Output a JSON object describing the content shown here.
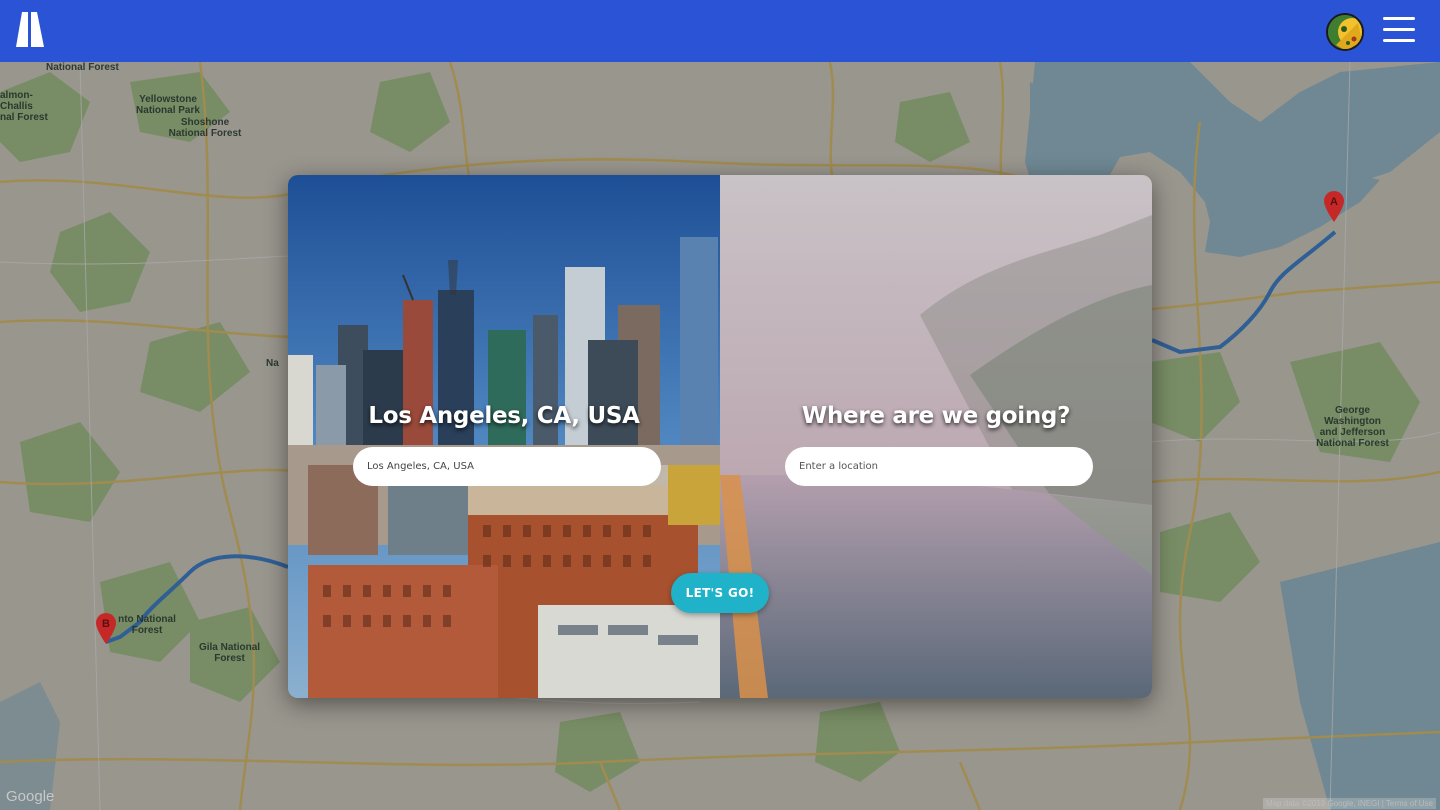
{
  "header": {
    "logo_icon": "trip-logo-icon",
    "avatar_icon": "user-avatar",
    "menu_icon": "hamburger-menu-icon",
    "brand_color": "#2b53d6"
  },
  "map": {
    "labels": [
      {
        "text": "National Forest"
      },
      {
        "text": "almon-\nChallis\nnal Forest"
      },
      {
        "text": "Yellowstone\nNational Park"
      },
      {
        "text": "Shoshone\nNational Forest"
      },
      {
        "text": "nto National\nForest"
      },
      {
        "text": "Gila National\nForest"
      },
      {
        "text": "George\nWashington\nand Jefferson\nNational Forest"
      },
      {
        "text": "Na"
      }
    ],
    "markers": [
      {
        "letter": "A",
        "color": "#d93025"
      },
      {
        "letter": "B",
        "color": "#d93025"
      }
    ],
    "google_label": "Google",
    "attribution": "Map data ©2019 Google, INEGI | Terms of Use"
  },
  "card": {
    "origin": {
      "title": "Los Angeles, CA, USA",
      "input_value": "Los Angeles, CA, USA",
      "input_placeholder": "Enter a location"
    },
    "destination": {
      "title": "Where are we going?",
      "input_value": "",
      "input_placeholder": "Enter a location"
    },
    "submit_label": "LET'S GO!",
    "accent_color": "#1fb2c8"
  }
}
